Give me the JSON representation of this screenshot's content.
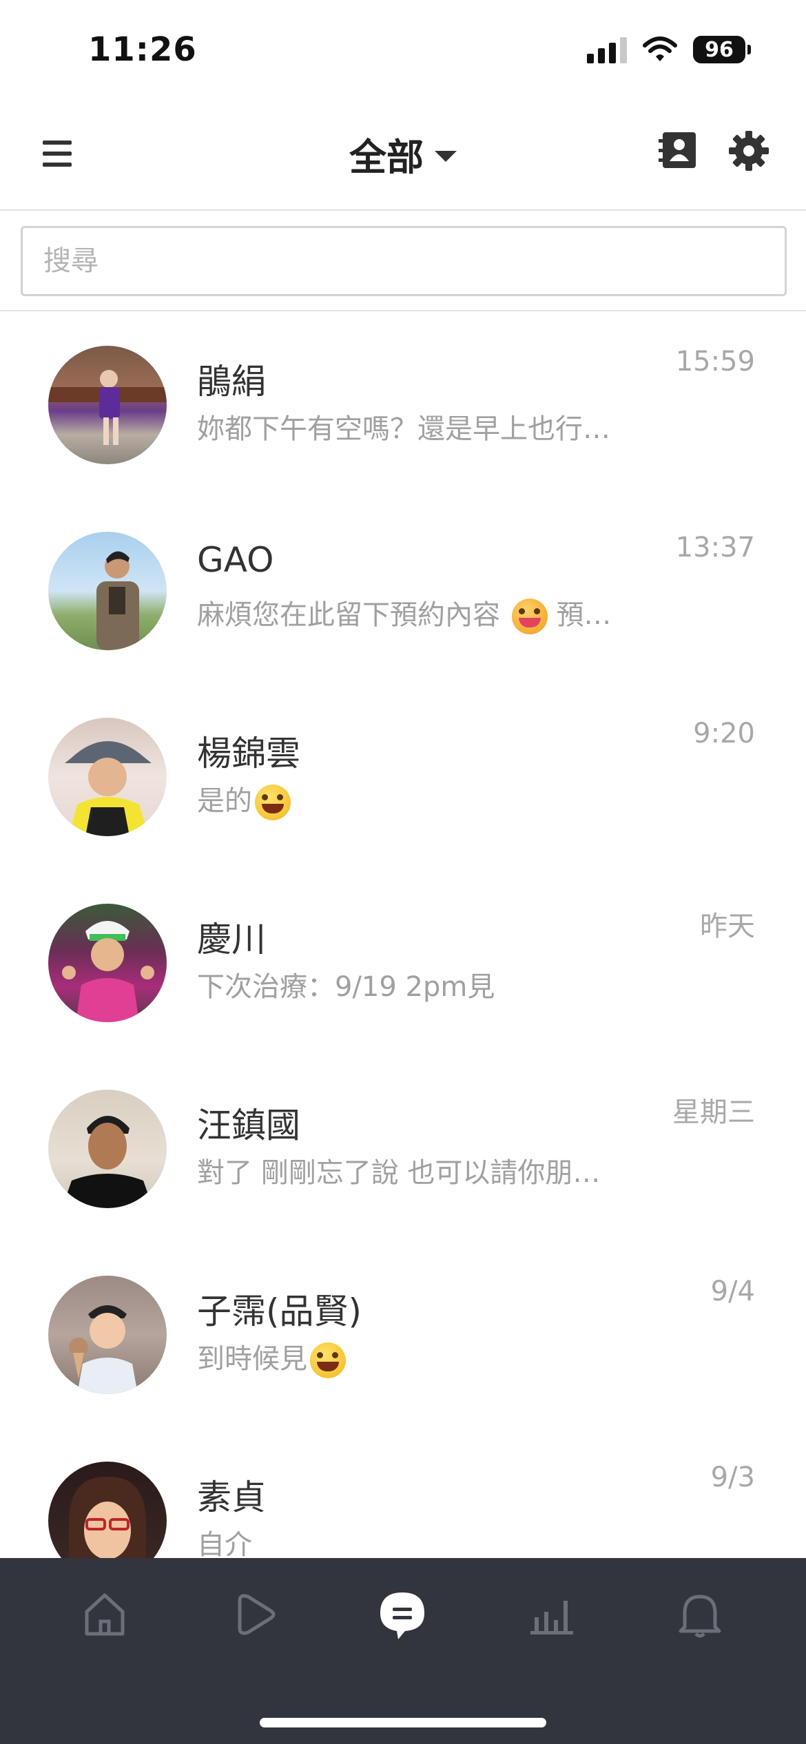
{
  "status_bar": {
    "time": "11:26",
    "battery_level": "96",
    "icons": [
      "signal-icon",
      "wifi-icon",
      "battery-icon"
    ]
  },
  "header": {
    "title": "全部",
    "left_icon": "hamburger-menu-icon",
    "right_icons": [
      "contact-book-icon",
      "gear-icon"
    ]
  },
  "search": {
    "placeholder": "搜尋"
  },
  "chats": [
    {
      "name": "鵑絹",
      "preview": "妳都下午有空嗎？還是早上也行…",
      "time": "15:59",
      "emoji": null
    },
    {
      "name": "GAO",
      "preview": "麻煩您在此留下預約內容",
      "preview_suffix": "預…",
      "time": "13:37",
      "emoji": "tongue-face"
    },
    {
      "name": "楊錦雲",
      "preview": "是的",
      "time": "9:20",
      "emoji": "grinning-face"
    },
    {
      "name": "慶川",
      "preview": "下次治療：9/19 2pm見",
      "time": "昨天",
      "emoji": null
    },
    {
      "name": "汪鎮國",
      "preview": "對了 剛剛忘了說 也可以請你朋…",
      "time": "星期三",
      "emoji": null
    },
    {
      "name": "子霈(品賢)",
      "preview": "到時候見",
      "time": "9/4",
      "emoji": "grinning-face"
    },
    {
      "name": "素貞",
      "preview": "自介",
      "time": "9/3",
      "emoji": null
    }
  ],
  "tab_bar": {
    "tabs": [
      "home-icon",
      "voom-play-icon",
      "chat-icon",
      "insights-chart-icon",
      "notification-bell-icon"
    ],
    "active_tab": "chat-icon"
  },
  "colors": {
    "tab_bar_bg": "#32353d",
    "inactive_icon": "#6b6f78",
    "active_icon": "#ffffff",
    "preview_text": "#a0a0a0"
  }
}
